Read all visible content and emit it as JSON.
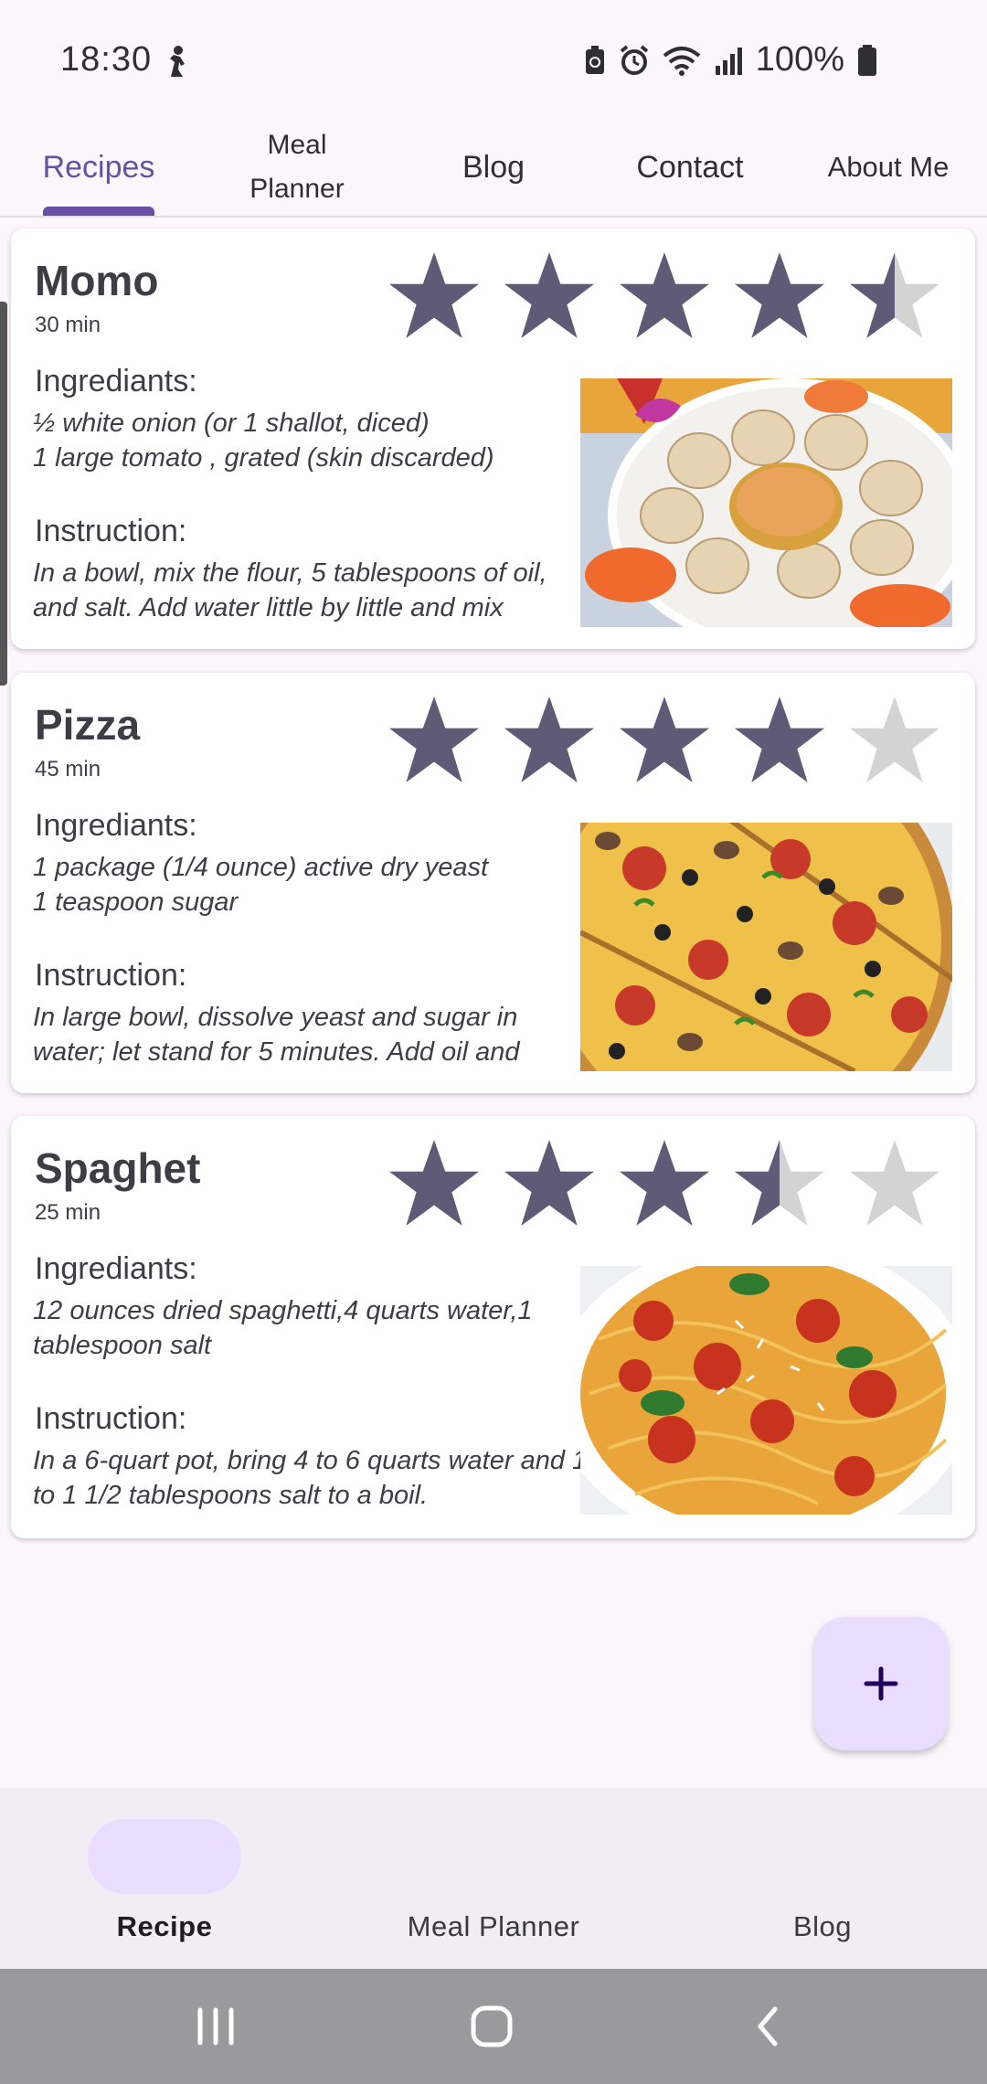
{
  "status_bar": {
    "time": "18:30",
    "battery": "100%",
    "icons": [
      "person-activity-icon",
      "battery-saver-icon",
      "alarm-icon",
      "wifi-icon",
      "signal-icon",
      "battery-icon"
    ]
  },
  "tabs": [
    {
      "label": "Recipes",
      "active": true
    },
    {
      "label": "Meal Planner",
      "active": false
    },
    {
      "label": "Blog",
      "active": false
    },
    {
      "label": "Contact",
      "active": false
    },
    {
      "label": "About Me",
      "active": false
    }
  ],
  "recipes": [
    {
      "title": "Momo",
      "time": "30 min",
      "rating": 4.5,
      "ingredients_label": "Ingrediants:",
      "ingredients": "½ white onion (or 1 shallot, diced)\n1 large tomato , grated (skin discarded)",
      "instruction_label": "Instruction:",
      "instruction": "In a bowl, mix the flour, 5 tablespoons of oil, and salt. Add water little by little and mix"
    },
    {
      "title": "Pizza",
      "time": "45 min",
      "rating": 4,
      "ingredients_label": "Ingrediants:",
      "ingredients": "1 package (1/4 ounce) active dry yeast\n1 teaspoon sugar",
      "instruction_label": "Instruction:",
      "instruction": "In large bowl, dissolve yeast and sugar in water; let stand for 5 minutes. Add oil and"
    },
    {
      "title": "Spaghet",
      "time": "25 min",
      "rating": 3.5,
      "ingredients_label": "Ingrediants:",
      "ingredients": "12 ounces dried spaghetti,4 quarts water,1 tablespoon salt",
      "instruction_label": "Instruction:",
      "instruction": "In a 6-quart pot, bring 4 to 6 quarts water and 1 to 1 1/2 tablespoons salt to a boil."
    }
  ],
  "fab": {
    "icon": "plus-icon"
  },
  "bottom_nav": [
    {
      "label": "Recipe",
      "active": true
    },
    {
      "label": "Meal Planner",
      "active": false
    },
    {
      "label": "Blog",
      "active": false
    }
  ],
  "colors": {
    "accent": "#6750a4",
    "star_filled": "#5f5a75",
    "star_empty": "#d3d3d3",
    "fab_bg": "#eaddff",
    "nav_bg": "#f2ecf4",
    "page_bg": "#fdf7fd"
  }
}
